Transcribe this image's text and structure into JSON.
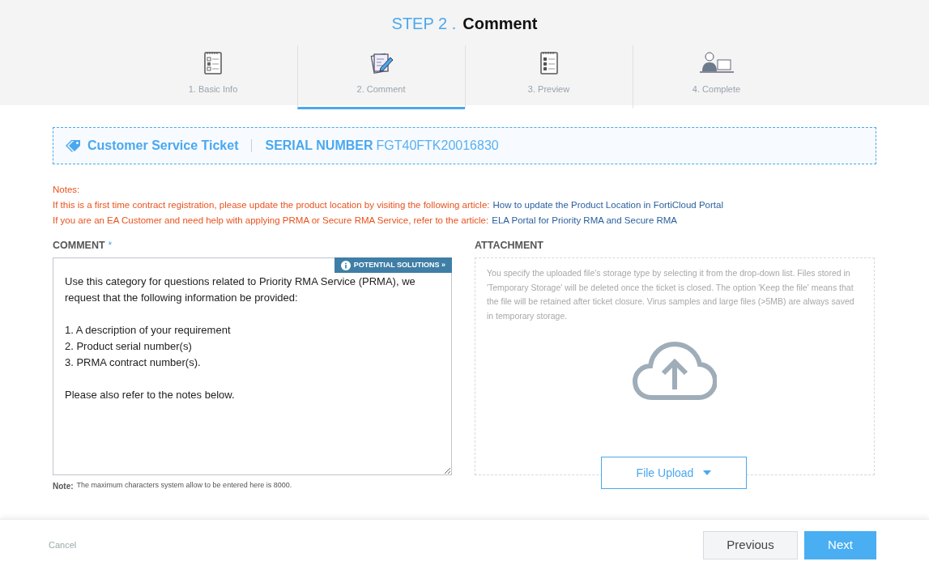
{
  "header": {
    "step": "STEP 2 .",
    "title": "Comment"
  },
  "steps": [
    {
      "label": "1. Basic Info",
      "kind": "form",
      "selected": false
    },
    {
      "label": "2. Comment",
      "kind": "edit",
      "selected": true
    },
    {
      "label": "3. Preview",
      "kind": "list",
      "selected": false
    },
    {
      "label": "4. Complete",
      "kind": "person",
      "selected": false
    }
  ],
  "ticket": {
    "type": "Customer Service Ticket",
    "serial_label": "SERIAL NUMBER",
    "serial": "FGT40FTK20016830"
  },
  "notes": {
    "title": "Notes:",
    "lines": [
      {
        "text": "If this is a first time contract registration, please update the product location by visiting the following article:",
        "link": "How to update the Product Location in FortiCloud Portal"
      },
      {
        "text": "If you are an EA Customer and need help with applying PRMA or Secure RMA Service, refer to the article:",
        "link": "ELA Portal for Priority RMA and Secure RMA"
      }
    ]
  },
  "comment": {
    "label": "COMMENT",
    "required": "*",
    "solutions_button": "POTENTIAL SOLUTIONS »",
    "value": "Use this category for questions related to Priority RMA Service (PRMA), we request that the following information be provided:\n\n1. A description of your requirement\n2. Product serial number(s)\n3. PRMA contract number(s).\n\nPlease also refer to the notes below.",
    "note_label": "Note:",
    "note": "The maximum characters system allow to be entered here is 8000."
  },
  "attachment": {
    "label": "ATTACHMENT",
    "description": "You specify the uploaded file's storage type by selecting it from the drop-down list. Files stored in 'Temporary Storage' will be deleted once the ticket is closed. The option 'Keep the file' means that the file will be retained after ticket closure. Virus samples and large files (>5MB) are always saved in temporary storage.",
    "upload_button": "File Upload"
  },
  "footer": {
    "cancel": "Cancel",
    "previous": "Previous",
    "next": "Next"
  }
}
